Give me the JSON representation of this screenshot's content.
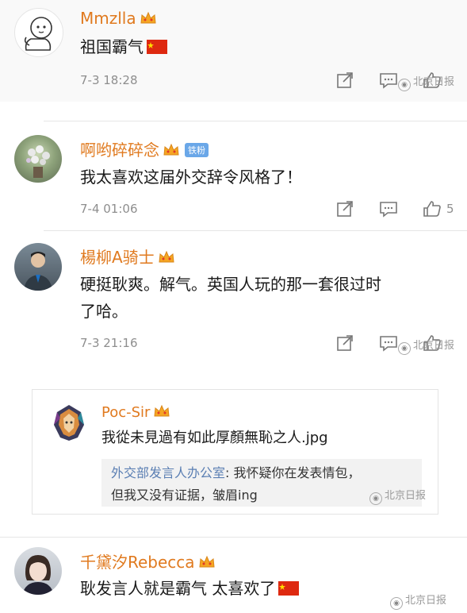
{
  "comments": [
    {
      "user": "Mmzlla",
      "text": "祖国霸气",
      "time": "7-3 18:28",
      "has_flag": true
    },
    {
      "user": "啊哟碎碎念",
      "badge": "铁粉",
      "text": "我太喜欢这届外交辞令风格了！",
      "time": "7-4 01:06",
      "likes": "5"
    },
    {
      "user": "楊柳A骑士",
      "text_line1": "硬挺耿爽。解气。英国人玩的那一套很过时",
      "text_line2": "了哈。",
      "time": "7-3 21:16"
    },
    {
      "user": "千黛汐Rebecca",
      "text": "耿发言人就是霸气 太喜欢了",
      "has_flag": true
    }
  ],
  "reply": {
    "user": "Poc-Sir",
    "text": "我從未見過有如此厚顏無恥之人.jpg",
    "quote_user": "外交部发言人办公室",
    "quote_sep": ":",
    "quote_line1": " 我怀疑你在发表情包，",
    "quote_line2": "但我又没有证据，皱眉ing"
  },
  "watermark": {
    "text": "北京日报"
  },
  "colors": {
    "username": "#e07a1f",
    "link": "#5b7fb3",
    "meta": "#8e8e8e"
  }
}
